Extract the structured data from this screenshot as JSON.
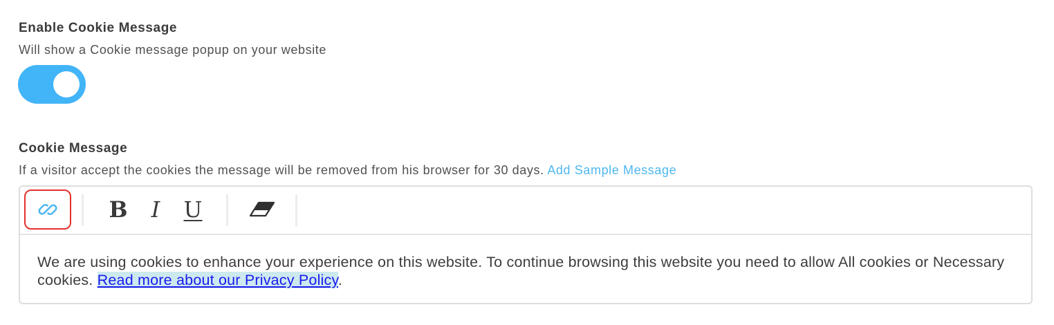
{
  "cookie_toggle": {
    "title": "Enable Cookie Message",
    "description": "Will show a Cookie message popup on your website",
    "enabled": true
  },
  "cookie_message": {
    "title": "Cookie Message",
    "description": "If a visitor accept the cookies the message will be removed from his browser for 30 days.",
    "sample_link": "Add Sample Message"
  },
  "toolbar": {
    "link_icon": "link-icon",
    "bold_label": "B",
    "italic_label": "I",
    "underline_label": "U",
    "clear_icon": "eraser-icon"
  },
  "editor": {
    "text": "We are using cookies to enhance your experience on this website. To continue browsing this website you need to allow All cookies or Necessary cookies.",
    "link_text": "Read more about our Privacy Policy",
    "trailing": "."
  },
  "colors": {
    "accent": "#42b4f8",
    "link": "#4fb8ef",
    "highlight": "#e3312b"
  }
}
